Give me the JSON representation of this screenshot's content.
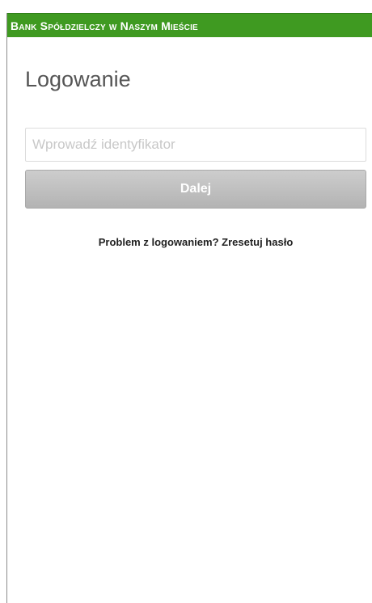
{
  "header": {
    "bank_name": "Bank Spółdzielczy w Naszym Mieście",
    "brand_color": "#3f9a21"
  },
  "login": {
    "title": "Logowanie",
    "id_input": {
      "value": "",
      "placeholder": "Wprowadź identyfikator"
    },
    "next_button_label": "Dalej",
    "reset_link_text": "Problem z logowaniem? Zresetuj hasło"
  }
}
